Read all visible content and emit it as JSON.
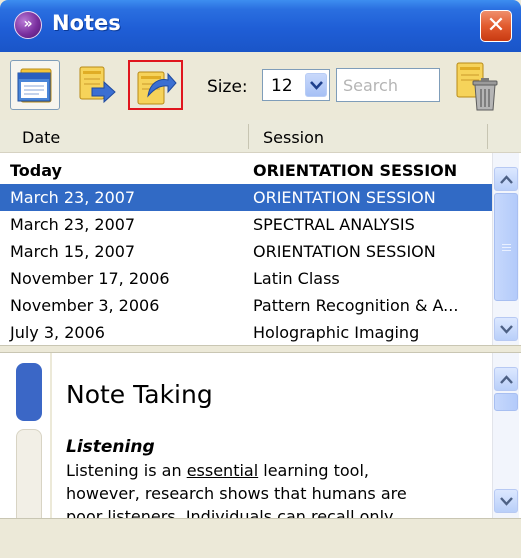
{
  "window": {
    "title": "Notes"
  },
  "icons": {
    "app": "notes-app-icon",
    "close": "close-icon",
    "view_notes": "notes-window-icon",
    "export": "export-note-icon",
    "import": "import-note-icon",
    "trash": "trash-icon",
    "dropdown": "chevron-down-icon",
    "scroll_up": "chevron-up-icon",
    "scroll_down": "chevron-down-icon"
  },
  "toolbar": {
    "size_label": "Size:",
    "size_value": "12",
    "search_placeholder": "Search",
    "search_value": ""
  },
  "table": {
    "columns": [
      "Date",
      "Session"
    ],
    "rows": [
      {
        "date": "Today",
        "session": "ORIENTATION SESSION",
        "bold": true,
        "selected": false
      },
      {
        "date": "March 23, 2007",
        "session": "ORIENTATION SESSION",
        "bold": false,
        "selected": true
      },
      {
        "date": "March 23, 2007",
        "session": "SPECTRAL ANALYSIS",
        "bold": false,
        "selected": false
      },
      {
        "date": "March 15, 2007",
        "session": "ORIENTATION SESSION",
        "bold": false,
        "selected": false
      },
      {
        "date": "November 17, 2006",
        "session": "Latin Class",
        "bold": false,
        "selected": false
      },
      {
        "date": "November 3, 2006",
        "session": "Pattern Recognition & A...",
        "bold": false,
        "selected": false
      },
      {
        "date": "July 3, 2006",
        "session": "Holographic Imaging",
        "bold": false,
        "selected": false
      }
    ]
  },
  "note": {
    "title": "Note Taking",
    "subheading": "Listening",
    "line1_before": "Listening is an ",
    "line1_underlined": "essential",
    "line1_after": " learning tool,",
    "line2": "however, research shows that humans are",
    "line3": "poor listeners. Individuals can recall only"
  },
  "colors": {
    "title_bar": "#1f5ed6",
    "selection": "#316ac5",
    "close_button": "#e25b2e",
    "highlight_border": "#e0161e",
    "section_tab": "#3b67c6"
  }
}
